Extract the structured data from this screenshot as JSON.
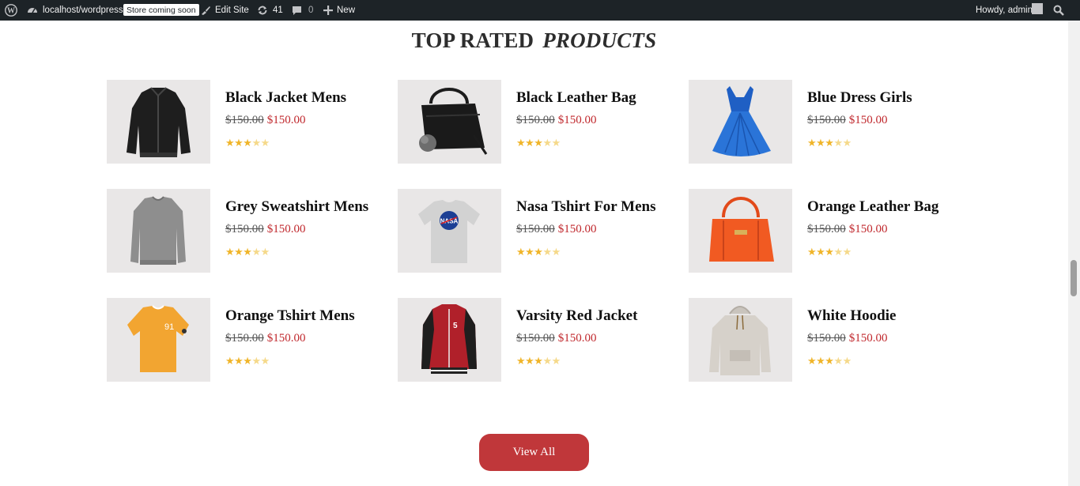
{
  "adminbar": {
    "site": "localhost/wordpress",
    "badge": "Store coming soon",
    "edit_site": "Edit Site",
    "updates": "41",
    "comments": "0",
    "new": "New",
    "howdy": "Howdy, admin"
  },
  "section": {
    "title_plain": "TOP RATED",
    "title_emph": "PRODUCTS"
  },
  "products": [
    {
      "name": "Black Jacket Mens",
      "old_price": "$150.00",
      "price": "$150.00",
      "rating": 3,
      "max_rating": 5,
      "image": "black-jacket"
    },
    {
      "name": "Black Leather Bag",
      "old_price": "$150.00",
      "price": "$150.00",
      "rating": 3,
      "max_rating": 5,
      "image": "black-bag"
    },
    {
      "name": "Blue Dress Girls",
      "old_price": "$150.00",
      "price": "$150.00",
      "rating": 3,
      "max_rating": 5,
      "image": "blue-dress"
    },
    {
      "name": "Grey Sweatshirt Mens",
      "old_price": "$150.00",
      "price": "$150.00",
      "rating": 3,
      "max_rating": 5,
      "image": "grey-sweatshirt"
    },
    {
      "name": "Nasa Tshirt For Mens",
      "old_price": "$150.00",
      "price": "$150.00",
      "rating": 3,
      "max_rating": 5,
      "image": "nasa-tshirt"
    },
    {
      "name": "Orange Leather Bag",
      "old_price": "$150.00",
      "price": "$150.00",
      "rating": 3,
      "max_rating": 5,
      "image": "orange-bag"
    },
    {
      "name": "Orange Tshirt Mens",
      "old_price": "$150.00",
      "price": "$150.00",
      "rating": 3,
      "max_rating": 5,
      "image": "orange-tshirt"
    },
    {
      "name": "Varsity Red Jacket",
      "old_price": "$150.00",
      "price": "$150.00",
      "rating": 3,
      "max_rating": 5,
      "image": "varsity-jacket"
    },
    {
      "name": "White Hoodie",
      "old_price": "$150.00",
      "price": "$150.00",
      "rating": 3,
      "max_rating": 5,
      "image": "white-hoodie"
    }
  ],
  "view_all": "View All",
  "colors": {
    "accent": "#c0373a",
    "sale_price": "#c0282d",
    "star": "#f0b52a",
    "adminbar": "#1d2327"
  }
}
